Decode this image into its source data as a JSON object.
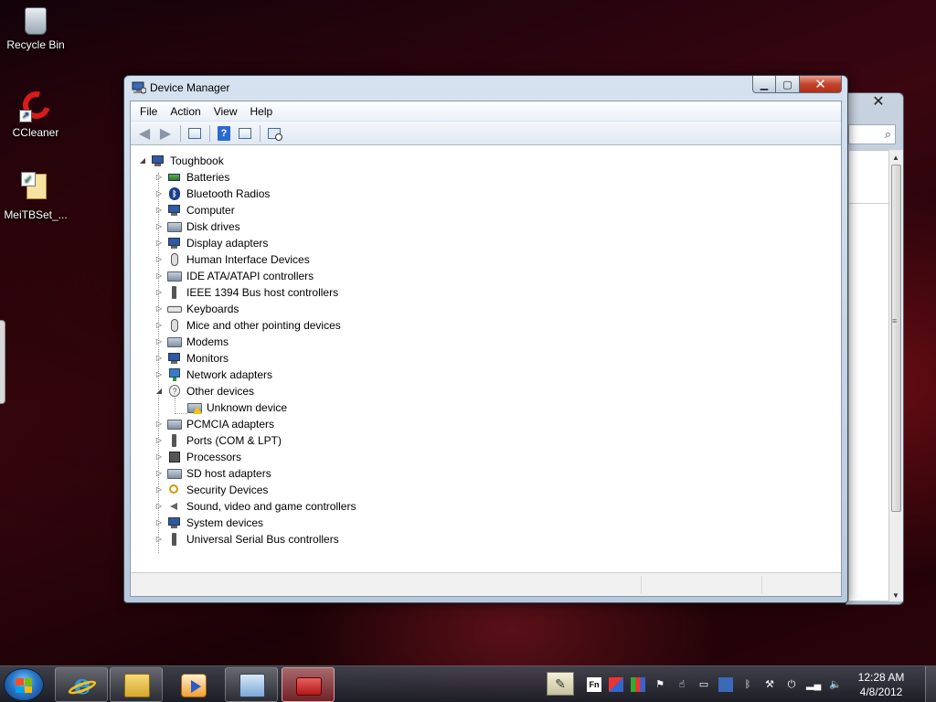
{
  "desktop": {
    "icons": [
      {
        "label": "Recycle Bin",
        "icon": "recycle-bin-icon"
      },
      {
        "label": "CCleaner",
        "icon": "ccleaner-icon"
      },
      {
        "label": "MeiTBSet_...",
        "icon": "file-icon"
      }
    ]
  },
  "window": {
    "title": "Device Manager",
    "controls": {
      "minimize": "minimize-icon",
      "maximize": "maximize-icon",
      "close": "close-icon"
    },
    "menu": [
      "File",
      "Action",
      "View",
      "Help"
    ],
    "toolbar": [
      "back-arrow-icon",
      "forward-arrow-icon",
      "show-hide-console-tree-icon",
      "help-icon",
      "properties-icon",
      "scan-hardware-icon"
    ],
    "tree": {
      "root": "Toughbook",
      "items": [
        {
          "label": "Batteries",
          "icon": "battery-icon",
          "expanded": false
        },
        {
          "label": "Bluetooth Radios",
          "icon": "bluetooth-icon",
          "expanded": false
        },
        {
          "label": "Computer",
          "icon": "computer-icon",
          "expanded": false
        },
        {
          "label": "Disk drives",
          "icon": "disk-drive-icon",
          "expanded": false
        },
        {
          "label": "Display adapters",
          "icon": "display-adapter-icon",
          "expanded": false
        },
        {
          "label": "Human Interface Devices",
          "icon": "hid-icon",
          "expanded": false
        },
        {
          "label": "IDE ATA/ATAPI controllers",
          "icon": "ide-controller-icon",
          "expanded": false
        },
        {
          "label": "IEEE 1394 Bus host controllers",
          "icon": "ieee1394-icon",
          "expanded": false
        },
        {
          "label": "Keyboards",
          "icon": "keyboard-icon",
          "expanded": false
        },
        {
          "label": "Mice and other pointing devices",
          "icon": "mouse-icon",
          "expanded": false
        },
        {
          "label": "Modems",
          "icon": "modem-icon",
          "expanded": false
        },
        {
          "label": "Monitors",
          "icon": "monitor-icon",
          "expanded": false
        },
        {
          "label": "Network adapters",
          "icon": "network-adapter-icon",
          "expanded": false
        },
        {
          "label": "Other devices",
          "icon": "unknown-device-icon",
          "expanded": true
        },
        {
          "label": "PCMCIA adapters",
          "icon": "pcmcia-icon",
          "expanded": false
        },
        {
          "label": "Ports (COM & LPT)",
          "icon": "port-icon",
          "expanded": false
        },
        {
          "label": "Processors",
          "icon": "processor-icon",
          "expanded": false
        },
        {
          "label": "SD host adapters",
          "icon": "sd-host-icon",
          "expanded": false
        },
        {
          "label": "Security Devices",
          "icon": "security-device-icon",
          "expanded": false
        },
        {
          "label": "Sound, video and game controllers",
          "icon": "sound-icon",
          "expanded": false
        },
        {
          "label": "System devices",
          "icon": "system-device-icon",
          "expanded": false
        },
        {
          "label": "Universal Serial Bus controllers",
          "icon": "usb-icon",
          "expanded": false
        }
      ],
      "child_of_other_devices": {
        "label": "Unknown device",
        "icon": "warning-device-icon"
      }
    }
  },
  "taskbar": {
    "apps": [
      "internet-explorer-icon",
      "windows-explorer-icon",
      "media-player-icon",
      "device-manager-icon",
      "toolbox-icon"
    ],
    "tray": [
      "pen-input-icon",
      "fn-key-icon",
      "tray-app-icon",
      "action-center-flag-icon",
      "tray-cursor-icon",
      "battery-tray-icon",
      "display-tray-icon",
      "bluetooth-tray-icon",
      "tools-tray-icon",
      "power-plug-icon",
      "network-signal-icon",
      "volume-icon"
    ],
    "fn_label": "Fn",
    "clock": {
      "time": "12:28 AM",
      "date": "4/8/2012"
    }
  },
  "colors": {
    "titlebar": "#c8d6e6",
    "close_button": "#c4442c",
    "taskbar": "#2a3140",
    "active_task": "#b02828"
  }
}
